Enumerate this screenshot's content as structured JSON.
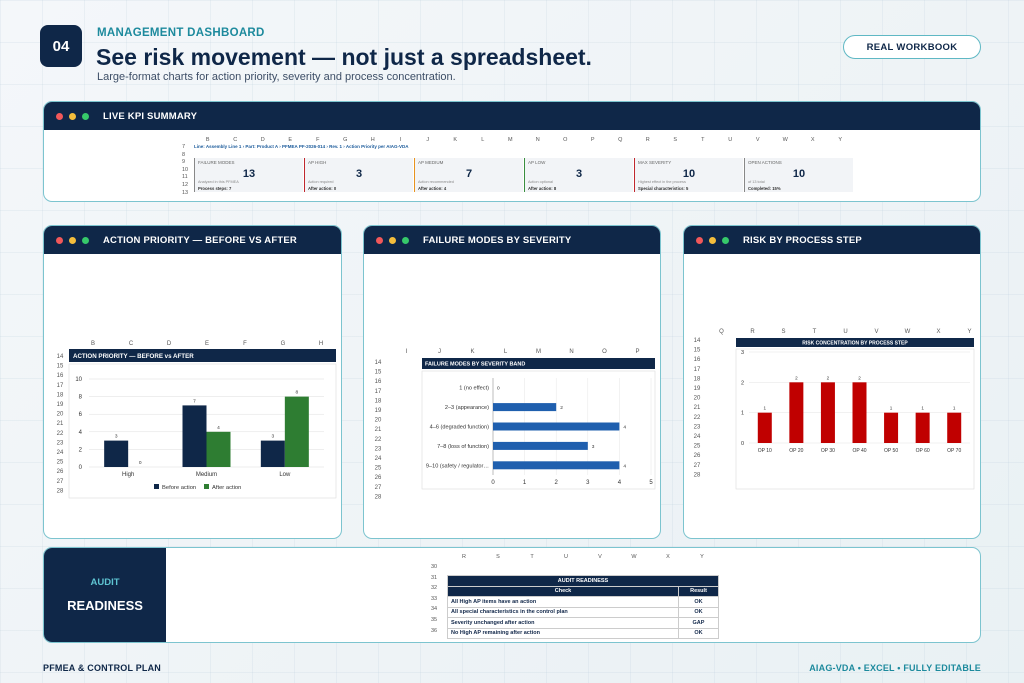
{
  "header": {
    "badge": "04",
    "kicker": "MANAGEMENT DASHBOARD",
    "title": "See risk movement — not just a spreadsheet.",
    "subtitle": "Large-format charts for action priority, severity and process concentration.",
    "pill": "REAL WORKBOOK"
  },
  "kpi_panel": {
    "title": "LIVE KPI SUMMARY",
    "columns": [
      "B",
      "C",
      "D",
      "E",
      "F",
      "G",
      "H",
      "I",
      "J",
      "K",
      "L",
      "M",
      "N",
      "O",
      "P",
      "Q",
      "R",
      "S",
      "T",
      "U",
      "V",
      "W",
      "X",
      "Y"
    ],
    "rows": [
      "7",
      "8",
      "9",
      "10",
      "11",
      "12",
      "13"
    ],
    "breadcrumb": "Line: Assembly Line 1   ›   Part: Product A   ›   PFMEA PF-2026-014   ›   Rev. 1   ›   Action Priority per AIAG-VDA",
    "cards": [
      {
        "label": "FAILURE MODES",
        "value": "13",
        "note": "Analyzed in this PFMEA",
        "after": "Process steps: 7",
        "color": "#888888"
      },
      {
        "label": "AP HIGH",
        "value": "3",
        "note": "Action required",
        "after": "After action: 0",
        "color": "#c0272d"
      },
      {
        "label": "AP MEDIUM",
        "value": "7",
        "note": "Action recommended",
        "after": "After action: 4",
        "color": "#e8931e"
      },
      {
        "label": "AP LOW",
        "value": "3",
        "note": "Action optional",
        "after": "After action: 8",
        "color": "#3a8e3f"
      },
      {
        "label": "MAX SEVERITY",
        "value": "10",
        "note": "Highest effect in the process",
        "after": "Special characteristics: 5",
        "color": "#c0272d"
      },
      {
        "label": "OPEN ACTIONS",
        "value": "10",
        "note": "of 13 total",
        "after": "Completed: 15%",
        "color": "#888888"
      }
    ]
  },
  "ap_panel": {
    "title": "ACTION PRIORITY — BEFORE VS AFTER",
    "columns": [
      "B",
      "C",
      "D",
      "E",
      "F",
      "G",
      "H"
    ],
    "rows": [
      "14",
      "15",
      "16",
      "17",
      "18",
      "19",
      "20",
      "21",
      "22",
      "23",
      "24",
      "25",
      "26",
      "27",
      "28"
    ],
    "sheet_title": "ACTION PRIORITY — BEFORE vs AFTER"
  },
  "sev_panel": {
    "title": "FAILURE MODES BY SEVERITY",
    "columns": [
      "I",
      "J",
      "K",
      "L",
      "M",
      "N",
      "O",
      "P"
    ],
    "rows": [
      "14",
      "15",
      "16",
      "17",
      "18",
      "19",
      "20",
      "21",
      "22",
      "23",
      "24",
      "25",
      "26",
      "27",
      "28"
    ],
    "sheet_title": "FAILURE MODES BY SEVERITY BAND"
  },
  "proc_panel": {
    "title": "RISK BY PROCESS STEP",
    "columns": [
      "Q",
      "R",
      "S",
      "T",
      "U",
      "V",
      "W",
      "X",
      "Y"
    ],
    "rows": [
      "14",
      "15",
      "16",
      "17",
      "18",
      "19",
      "20",
      "21",
      "22",
      "23",
      "24",
      "25",
      "26",
      "27",
      "28"
    ],
    "sheet_title": "RISK CONCENTRATION BY PROCESS STEP"
  },
  "audit_panel": {
    "kicker": "AUDIT",
    "title": "READINESS",
    "columns": [
      "R",
      "S",
      "T",
      "U",
      "V",
      "W",
      "X",
      "Y"
    ],
    "rows": [
      "30",
      "31",
      "32",
      "33",
      "34",
      "35",
      "36"
    ],
    "table_title": "AUDIT READINESS",
    "col_check": "Check",
    "col_result": "Result",
    "items": [
      {
        "check": "All High AP items have an action",
        "result": "OK"
      },
      {
        "check": "All special characteristics in the control plan",
        "result": "OK"
      },
      {
        "check": "Severity unchanged after action",
        "result": "GAP"
      },
      {
        "check": "No High AP remaining after action",
        "result": "OK"
      }
    ]
  },
  "footer": {
    "left": "PFMEA & CONTROL PLAN",
    "right": "AIAG-VDA  •  EXCEL  •  FULLY EDITABLE"
  },
  "chart_data": [
    {
      "type": "bar",
      "title": "ACTION PRIORITY — BEFORE vs AFTER",
      "categories": [
        "High",
        "Medium",
        "Low"
      ],
      "series": [
        {
          "name": "Before action",
          "values": [
            3,
            7,
            3
          ],
          "color": "#0f2748"
        },
        {
          "name": "After action",
          "values": [
            0,
            4,
            8
          ],
          "color": "#2e7d32"
        }
      ],
      "ylim": [
        0,
        10
      ],
      "yticks": [
        0,
        2,
        4,
        6,
        8,
        10
      ],
      "legend": "bottom"
    },
    {
      "type": "bar",
      "orientation": "horizontal",
      "title": "FAILURE MODES BY SEVERITY BAND",
      "categories": [
        "1 (no effect)",
        "2–3 (appearance)",
        "4–6 (degraded function)",
        "7–8 (loss of function)",
        "9–10 (safety / regulator…"
      ],
      "values": [
        0,
        2,
        4,
        3,
        4
      ],
      "xlim": [
        0,
        5
      ],
      "xticks": [
        0,
        1,
        2,
        3,
        4,
        5
      ],
      "color": "#1f5fae"
    },
    {
      "type": "bar",
      "title": "RISK CONCENTRATION BY PROCESS STEP",
      "categories": [
        "OP 10",
        "OP 20",
        "OP 30",
        "OP 40",
        "OP 50",
        "OP 60",
        "OP 70"
      ],
      "values": [
        1,
        2,
        2,
        2,
        1,
        1,
        1
      ],
      "ylim": [
        0,
        3
      ],
      "yticks": [
        0,
        1,
        2,
        3
      ],
      "color": "#c00000"
    }
  ]
}
